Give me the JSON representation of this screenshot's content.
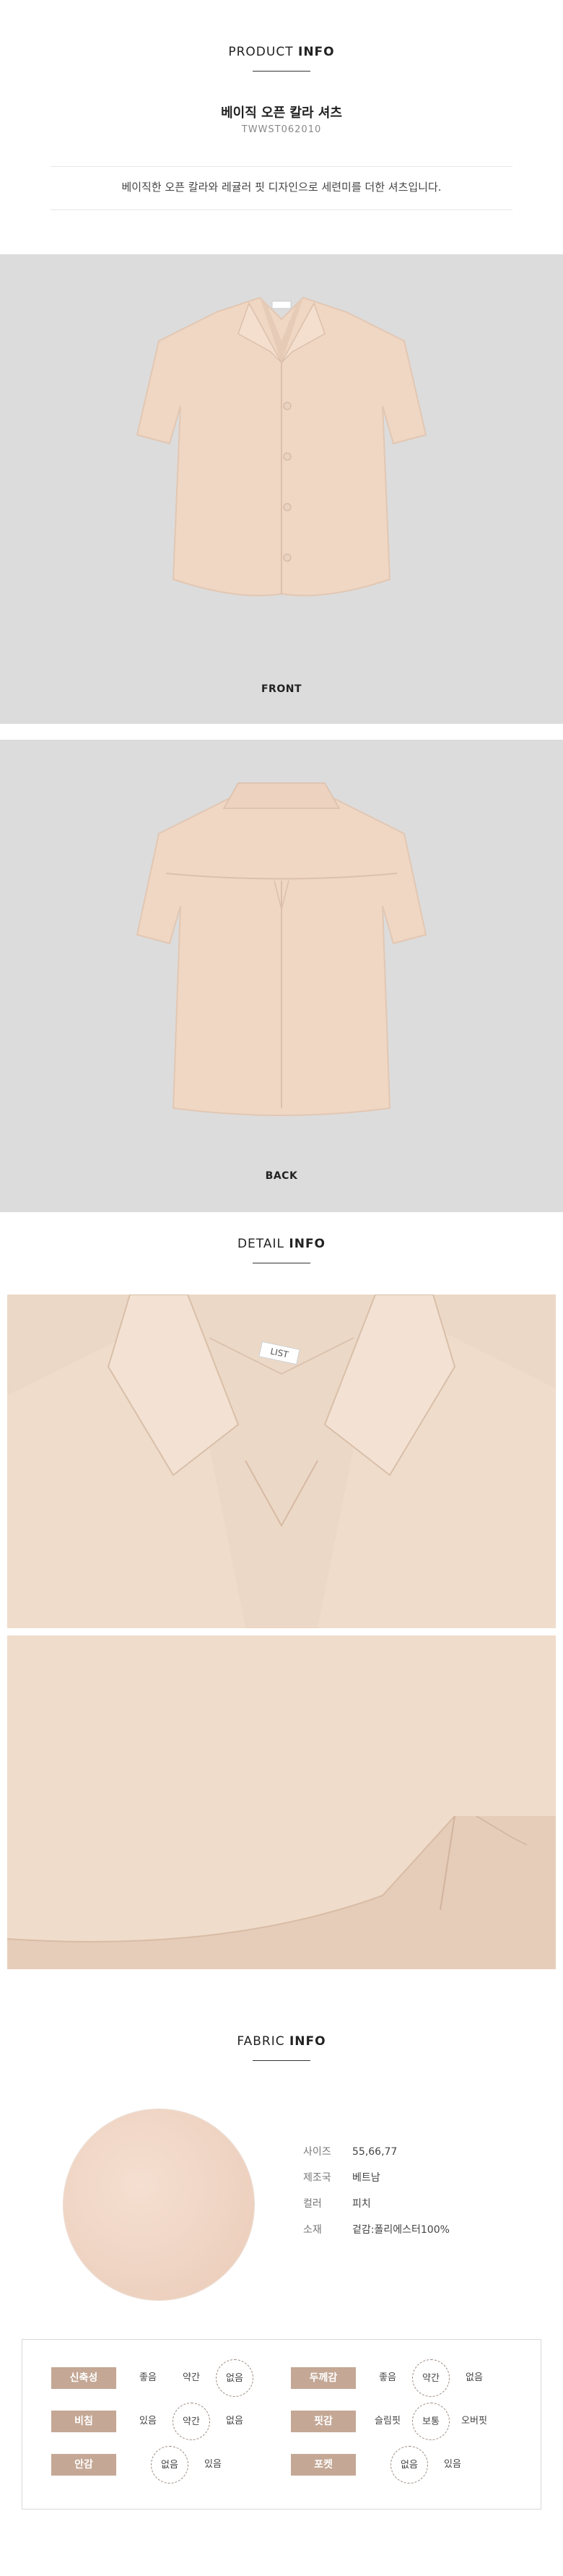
{
  "product_info": {
    "title_light": "PRODUCT ",
    "title_bold": "INFO",
    "name": "베이직 오픈 칼라 셔츠",
    "code": "TWWST062010",
    "description": "베이직한 오픈 칼라와 레귤러 핏 디자인으로 세련미를 더한 셔츠입니다."
  },
  "photos": {
    "front_label": "FRONT",
    "back_label": "BACK",
    "neck_tag": "LIST"
  },
  "detail_info": {
    "title_light": "DETAIL ",
    "title_bold": "INFO"
  },
  "fabric_info": {
    "title_light": "FABRIC ",
    "title_bold": "INFO",
    "specs": [
      {
        "label": "사이즈",
        "value": "55,66,77"
      },
      {
        "label": "제조국",
        "value": "베트남"
      },
      {
        "label": "컬러",
        "value": "피치"
      },
      {
        "label": "소재",
        "value": "겉감:폴리에스터100%"
      }
    ]
  },
  "ratings": [
    {
      "name": "신축성",
      "options": [
        "좋음",
        "약간",
        "없음"
      ],
      "selected": 2
    },
    {
      "name": "두께감",
      "options": [
        "좋음",
        "약간",
        "없음"
      ],
      "selected": 1
    },
    {
      "name": "비침",
      "options": [
        "있음",
        "약간",
        "없음"
      ],
      "selected": 1
    },
    {
      "name": "핏감",
      "options": [
        "슬림핏",
        "보통",
        "오버핏"
      ],
      "selected": 1
    },
    {
      "name": "안감",
      "options": [
        "없음",
        "있음"
      ],
      "selected": 0
    },
    {
      "name": "포켓",
      "options": [
        "없음",
        "있음"
      ],
      "selected": 0
    }
  ],
  "colors": {
    "shirt": "#efd7c4",
    "shirt_shadow": "#e0c3ae",
    "panel_bg": "#dcdcdc",
    "tag_bg": "#c4a795"
  }
}
